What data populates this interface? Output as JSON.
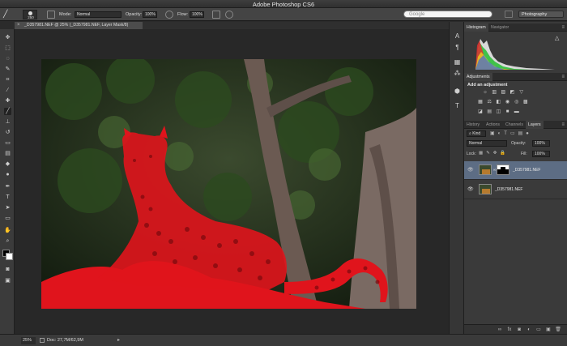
{
  "app": {
    "title": "Adobe Photoshop CS6"
  },
  "search": {
    "placeholder": "Google"
  },
  "workspace": {
    "value": "Photography"
  },
  "options": {
    "brush_size": "250",
    "mode_label": "Mode:",
    "mode_value": "Normal",
    "opacity_label": "Opacity:",
    "opacity_value": "100%",
    "flow_label": "Flow:",
    "flow_value": "100%"
  },
  "document": {
    "tab_title": "_D357981.NEF @ 25% (_D357981.NEF, Layer Mask/8)",
    "close_glyph": "×"
  },
  "status": {
    "zoom": "25%",
    "doc_size": "Doc: 27,7M/62,9M"
  },
  "panels": {
    "histogram_tab": "Histogram",
    "navigator_tab": "Navigator",
    "adjustments_tab": "Adjustments",
    "add_adjustment": "Add an adjustment",
    "history_tab": "History",
    "actions_tab": "Actions",
    "channels_tab": "Channels",
    "layers_tab": "Layers",
    "kind_filter": "Kind",
    "blend_mode": "Normal",
    "opacity_label": "Opacity:",
    "opacity_value": "100%",
    "lock_label": "Lock:",
    "fill_label": "Fill:",
    "fill_value": "100%"
  },
  "layers": [
    {
      "name": "_D357981.NEF",
      "selected": true,
      "has_mask": true
    },
    {
      "name": "_D357981.NEF",
      "selected": false,
      "has_mask": false
    }
  ],
  "colors": {
    "mask_overlay": "#e0141c",
    "selection": "#5d6d84",
    "ui_dark": "#2b2b2b"
  }
}
